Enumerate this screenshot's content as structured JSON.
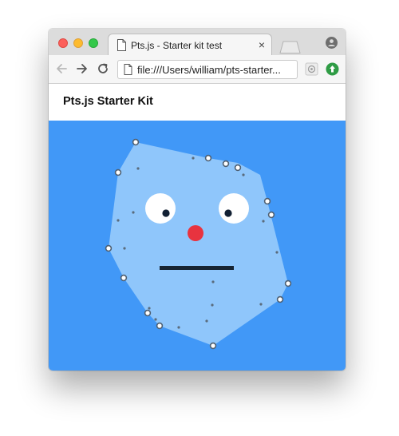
{
  "browser": {
    "tab": {
      "title": "Pts.js - Starter kit test",
      "close_glyph": "×",
      "icon": "document-icon"
    },
    "address_bar": {
      "url": "file:///Users/william/pts-starter..."
    },
    "nav": {
      "back_icon": "arrow-left-icon",
      "forward_icon": "arrow-right-icon",
      "reload_icon": "reload-icon"
    },
    "extensions": [
      "puzzle-extension-icon",
      "green-upload-extension-icon"
    ],
    "profile_icon": "person-circle-icon"
  },
  "page": {
    "title": "Pts.js Starter Kit"
  },
  "scene": {
    "background_color": "#4198f7",
    "blob_color": "#8fc6fb",
    "dot_color": "#5a6b7c",
    "eye_white": "#ffffff",
    "pupil_color": "#122033",
    "nose_color": "#e8333f",
    "mouth_color": "#162433"
  }
}
